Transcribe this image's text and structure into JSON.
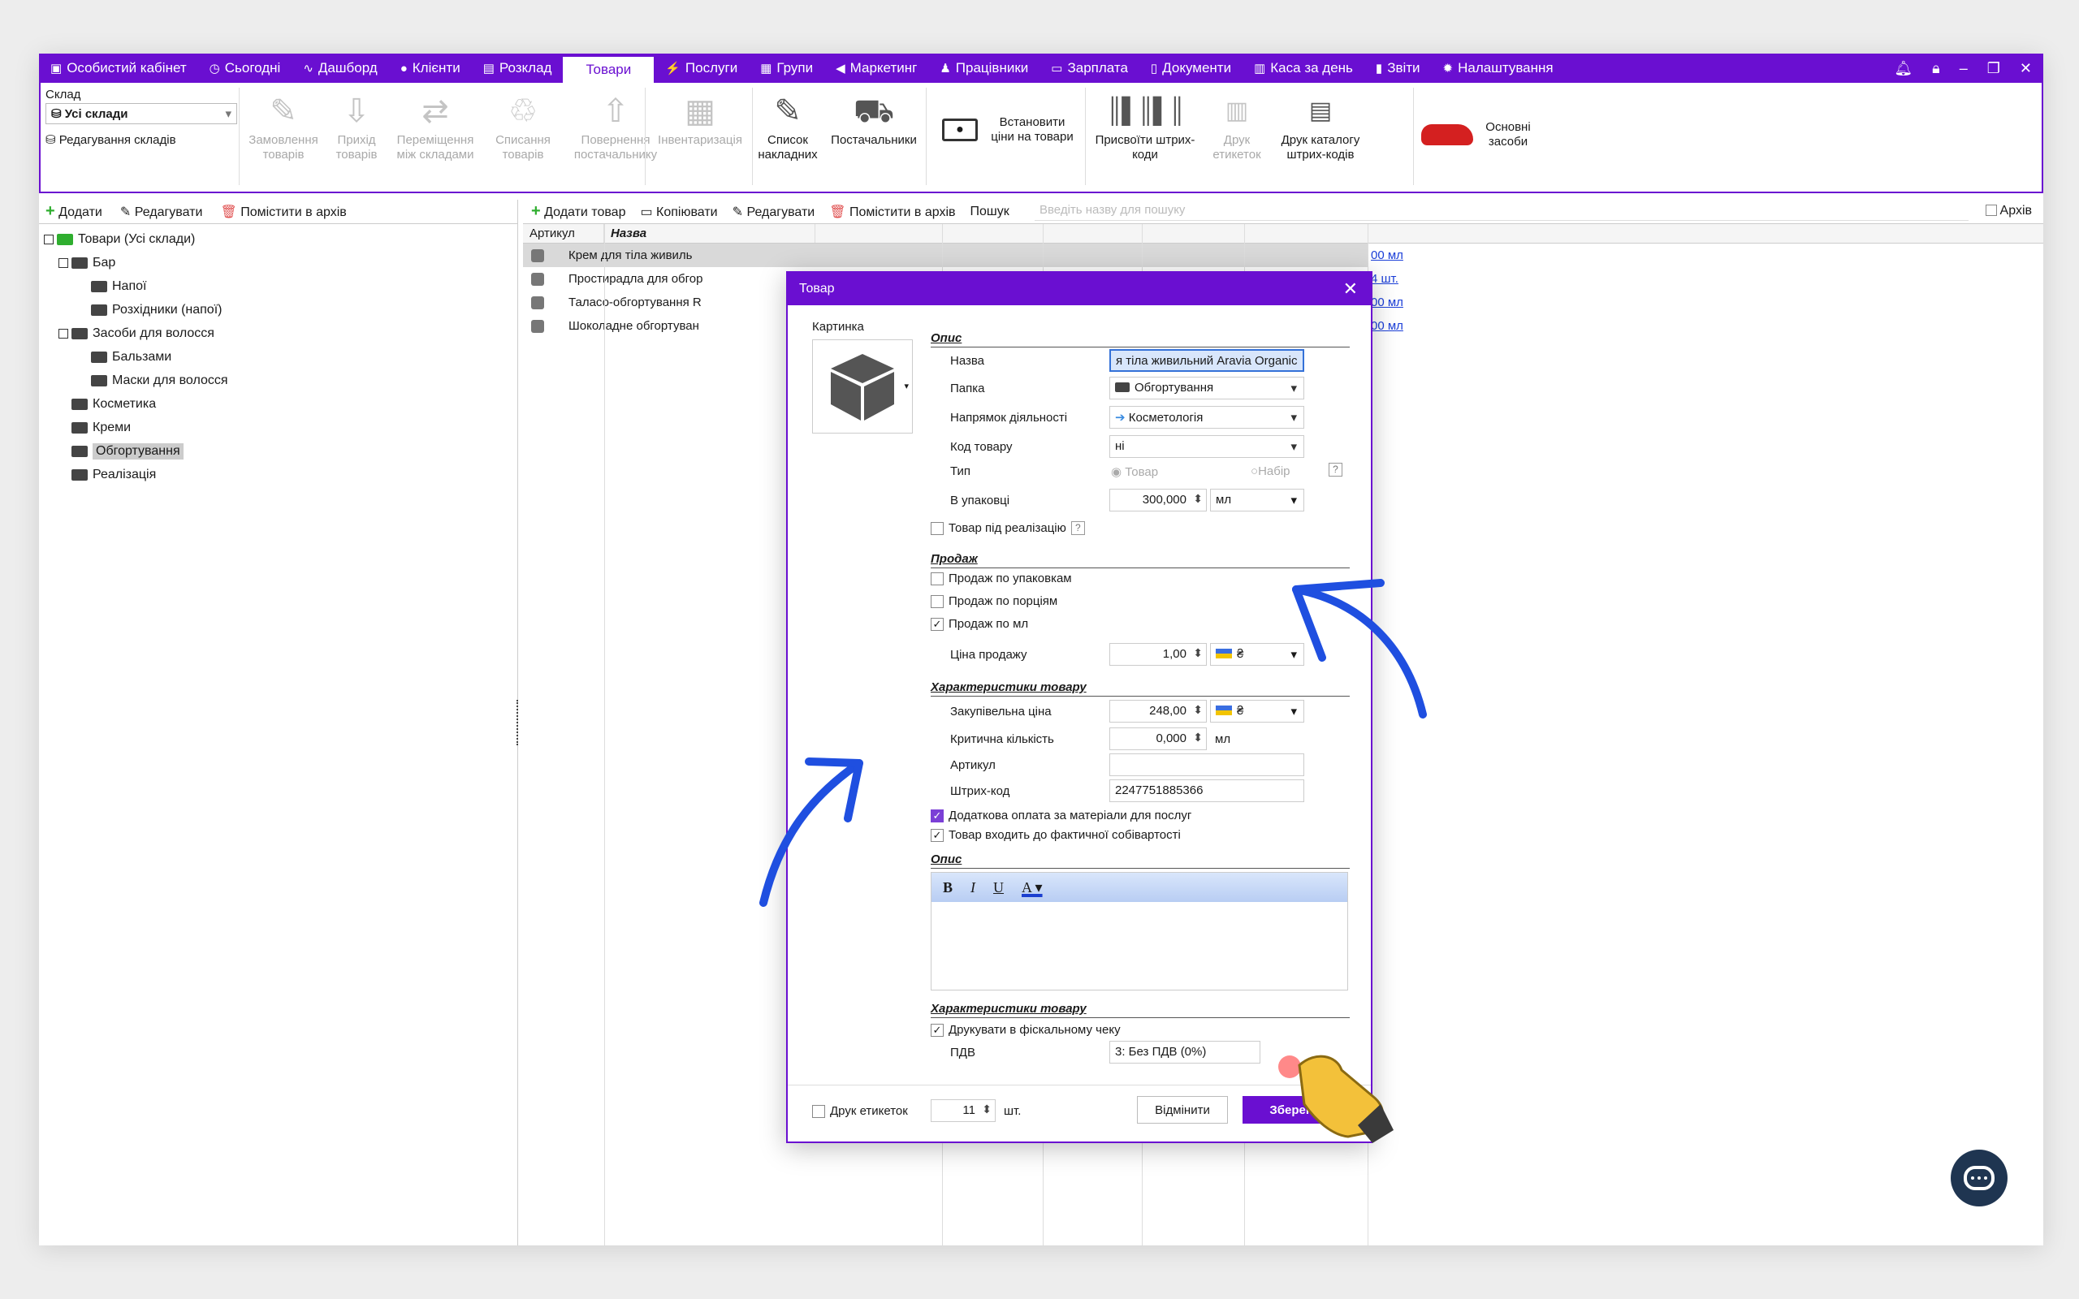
{
  "topnav": {
    "items": [
      {
        "label": "Особистий кабінет",
        "icon": "cabinet-icon"
      },
      {
        "label": "Сьогодні",
        "icon": "clock-icon"
      },
      {
        "label": "Дашборд",
        "icon": "pulse-icon"
      },
      {
        "label": "Клієнти",
        "icon": "user-icon"
      },
      {
        "label": "Розклад",
        "icon": "calendar-icon"
      },
      {
        "label": "Товари",
        "icon": ""
      },
      {
        "label": "Послуги",
        "icon": "lightning-icon"
      },
      {
        "label": "Групи",
        "icon": "groups-icon"
      },
      {
        "label": "Маркетинг",
        "icon": "megaphone-icon"
      },
      {
        "label": "Працівники",
        "icon": "person-icon"
      },
      {
        "label": "Зарплата",
        "icon": "money-icon"
      },
      {
        "label": "Документи",
        "icon": "document-icon"
      },
      {
        "label": "Каса за день",
        "icon": "calculator-icon"
      },
      {
        "label": "Звіти",
        "icon": "bars-icon"
      },
      {
        "label": "Налаштування",
        "icon": "gear-icon"
      }
    ],
    "active": "Товари"
  },
  "ribbon": {
    "sklad_label": "Склад",
    "sklad_value": "Усі склади",
    "edit_warehouses": "Редагування складів",
    "buttons": {
      "order": "Замовлення товарів",
      "receipt": "Прихід товарів",
      "move": "Переміщення між складами",
      "writeoff": "Списання товарів",
      "return": "Повернення постачальнику",
      "inventory": "Інвентаризація",
      "invoices": "Список накладних",
      "suppliers": "Постачальники",
      "set_prices": "Встановити ціни на товари",
      "assign_barcodes": "Присвоїти штрих-коди",
      "print_labels": "Друк етикеток",
      "print_catalog": "Друк каталогу штрих-кодів",
      "assets": "Основні засоби"
    }
  },
  "leftpanel": {
    "add": "Додати",
    "edit": "Редагувати",
    "archive": "Помістити в архів",
    "tree": [
      {
        "label": "Товари (Усі склади)",
        "level": 0
      },
      {
        "label": "Бар",
        "level": 1
      },
      {
        "label": "Напої",
        "level": 2
      },
      {
        "label": "Розхідники (напої)",
        "level": 2
      },
      {
        "label": "Засоби для волосся",
        "level": 1
      },
      {
        "label": "Бальзами",
        "level": 2
      },
      {
        "label": "Маски для волосся",
        "level": 2
      },
      {
        "label": "Косметика",
        "level": 1
      },
      {
        "label": "Креми",
        "level": 1
      },
      {
        "label": "Обгортування",
        "level": 1
      },
      {
        "label": "Реалізація",
        "level": 1
      }
    ]
  },
  "mainpanel": {
    "add_product": "Додати товар",
    "copy": "Копіювати",
    "edit": "Редагувати",
    "archive": "Помістити в архів",
    "search_label": "Пошук",
    "search_placeholder": "Введіть назву для пошуку",
    "archive_check": "Архів",
    "col_article": "Артикул",
    "col_name": "Назва",
    "rows": [
      {
        "name": "Крем для тіла живиль",
        "qty": "00 мл"
      },
      {
        "name": "Простирадла для обгор",
        "qty": "4 шт."
      },
      {
        "name": "Таласо-обгортування R",
        "qty": "00 мл"
      },
      {
        "name": "Шоколадне обгортуван",
        "qty": "00 мл"
      }
    ]
  },
  "modal": {
    "title": "Товар",
    "picture_label": "Картинка",
    "section_opis": "Опис",
    "name_label": "Назва",
    "name_value": "я тіла живильний Aravia Organic",
    "folder_label": "Папка",
    "folder_value": "Обгортування",
    "direction_label": "Напрямок діяльності",
    "direction_value": "Косметологія",
    "code_label": "Код товару",
    "code_value": "ні",
    "type_label": "Тип",
    "type_product": "Товар",
    "type_set": "Набір",
    "pack_label": "В упаковці",
    "pack_value": "300,000",
    "pack_unit": "мл",
    "realization_label": "Товар під реалізацію",
    "section_sale": "Продаж",
    "sale_pack": "Продаж по упаковкам",
    "sale_portion": "Продаж по порціям",
    "sale_ml": "Продаж по мл",
    "sale_price_label": "Ціна продажу",
    "sale_price_value": "1,00",
    "currency": "₴",
    "section_chars": "Характеристики товару",
    "purchase_label": "Закупівельна ціна",
    "purchase_value": "248,00",
    "critical_label": "Критична кількість",
    "critical_value": "0,000",
    "critical_unit": "мл",
    "article_label": "Артикул",
    "article_value": "",
    "barcode_label": "Штрих-код",
    "barcode_value": "2247751885366",
    "extra_payment": "Додаткова оплата за матеріали для послуг",
    "in_cost": "Товар входить до фактичної собівартості",
    "section_desc": "Опис",
    "section_chars2": "Характеристики товару",
    "fiscal": "Друкувати в фіскальному чеку",
    "vat_label": "ПДВ",
    "vat_value": "3: Без ПДВ (0%)",
    "print_labels": "Друк етикеток",
    "labels_count": "11",
    "labels_unit": "шт.",
    "cancel": "Відмінити",
    "save": "Зберегти"
  }
}
